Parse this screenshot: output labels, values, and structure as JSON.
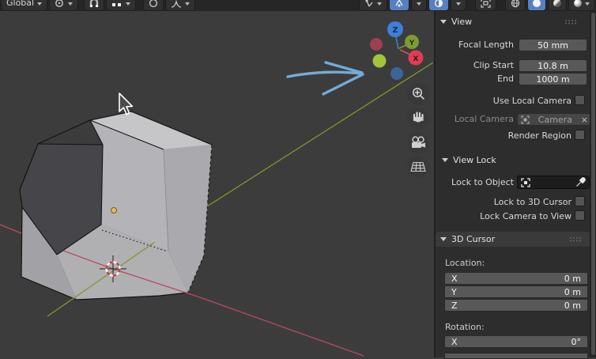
{
  "topbar": {
    "orientation": "Global"
  },
  "viewport": {
    "gizmo": {
      "z_label": "Z",
      "y_label": "Y",
      "x_label": "X"
    }
  },
  "panel": {
    "view": {
      "title": "View",
      "focal_label": "Focal Length",
      "focal_value": "50 mm",
      "clip_start_label": "Clip Start",
      "clip_start_value": "10.8 m",
      "clip_end_label": "End",
      "clip_end_value": "1000 m",
      "use_local_camera_label": "Use Local Camera",
      "local_camera_label": "Local Camera",
      "local_camera_value": "Camera",
      "local_camera_clear": "×",
      "render_region_label": "Render Region"
    },
    "view_lock": {
      "title": "View Lock",
      "lock_to_object_label": "Lock to Object",
      "lock_to_3d_cursor_label": "Lock to 3D Cursor",
      "lock_camera_to_view_label": "Lock Camera to View"
    },
    "cursor_3d": {
      "title": "3D Cursor",
      "location_label": "Location:",
      "rotation_label": "Rotation:",
      "location": [
        {
          "axis": "X",
          "value": "0 m"
        },
        {
          "axis": "Y",
          "value": "0 m"
        },
        {
          "axis": "Z",
          "value": "0 m"
        }
      ],
      "rotation": [
        {
          "axis": "X",
          "value": "0°"
        }
      ]
    }
  },
  "colors": {
    "accent": "#5680c2",
    "axis_x": "#b84a60",
    "axis_y": "#7c9a2a",
    "axis_z": "#3e80d8",
    "annotation_arrow": "#74aad8"
  }
}
